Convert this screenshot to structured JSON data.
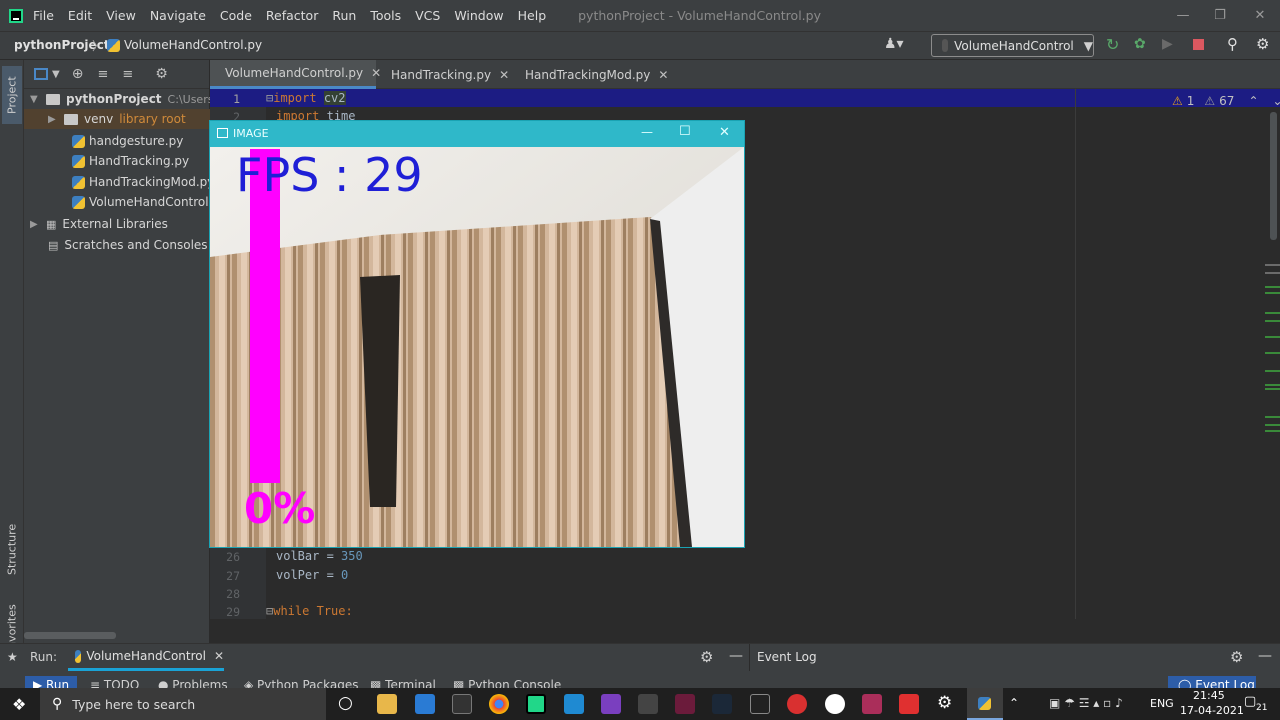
{
  "menubar": {
    "items": [
      "File",
      "Edit",
      "View",
      "Navigate",
      "Code",
      "Refactor",
      "Run",
      "Tools",
      "VCS",
      "Window",
      "Help"
    ],
    "window_title": "pythonProject - VolumeHandControl.py"
  },
  "navbar": {
    "project": "pythonProject",
    "file": "VolumeHandControl.py",
    "run_config": "VolumeHandControl"
  },
  "sidebar": {
    "project_tab": "Project",
    "structure_tab": "Structure",
    "favorites_tab": "Favorites"
  },
  "project_tree": {
    "root": "pythonProject",
    "root_path": "C:\\Users\\ba",
    "venv": "venv",
    "venv_note": "library root",
    "files": [
      "handgesture.py",
      "HandTracking.py",
      "HandTrackingMod.py",
      "VolumeHandControl.py"
    ],
    "external": "External Libraries",
    "scratches": "Scratches and Consoles"
  },
  "tabs": [
    "VolumeHandControl.py",
    "HandTracking.py",
    "HandTrackingMod.py"
  ],
  "inspections": {
    "warnings": "1",
    "weak_warnings": "67"
  },
  "code": {
    "line1_num": "1",
    "line1_kw": "import",
    "line1_mod": "cv2",
    "line2_num": "2",
    "line2_kw": "import",
    "line2_mod": "time",
    "line26_num": "26",
    "line26_var": "volBar = ",
    "line26_val": "350",
    "line27_num": "27",
    "line27_var": "volPer = ",
    "line27_val": "0",
    "line28_num": "28",
    "line29_num": "29",
    "line29_kw": "while",
    "line29_rest": "True:"
  },
  "image_window": {
    "title": "IMAGE",
    "fps_text": "FPS : 29",
    "volume_text": "0%",
    "volume_percent": 0
  },
  "runbar": {
    "label": "Run:",
    "config": "VolumeHandControl",
    "event_log": "Event Log"
  },
  "toolbuttons": [
    "Run",
    "TODO",
    "Problems",
    "Python Packages",
    "Terminal",
    "Python Console",
    "Event Log"
  ],
  "taskbar": {
    "search_placeholder": "Type here to search",
    "lang": "ENG",
    "time": "21:45",
    "date": "17-04-2021",
    "notifications": "21"
  },
  "colors": {
    "accent": "#4a88c7",
    "fps_text": "#1f1fd6",
    "volume_bar": "#ff00ff",
    "image_titlebar": "#2fb8c9"
  }
}
